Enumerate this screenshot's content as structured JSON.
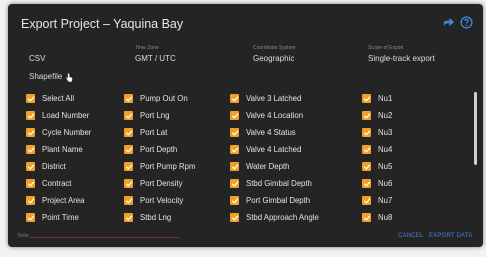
{
  "dialog": {
    "title": "Export Project – Yaquina Bay",
    "icons": [
      "share-arrow-icon",
      "help-icon"
    ],
    "accent_color": "#f0a125",
    "link_color": "#3d86d6"
  },
  "options": {
    "format": {
      "label": "",
      "value": "CSV",
      "value2": "Shapefile"
    },
    "time_zone": {
      "label": "Time Zone",
      "value": "GMT / UTC"
    },
    "coordinate_system": {
      "label": "Coordinate System",
      "value": "Geographic"
    },
    "scope": {
      "label": "Scope of Export",
      "value": "Single-track export"
    }
  },
  "fields": {
    "col1": [
      "Select All",
      "Load Number",
      "Cycle Number",
      "Plant Name",
      "District",
      "Contract",
      "Project Area",
      "Point Time"
    ],
    "col2": [
      "Pump Out On",
      "Port Lng",
      "Port Lat",
      "Port Depth",
      "Port Pump Rpm",
      "Port Density",
      "Port Velocity",
      "Stbd Lng"
    ],
    "col3": [
      "Valve 3 Latched",
      "Valve 4 Location",
      "Valve 4 Status",
      "Valve 4 Latched",
      "Water Depth",
      "Stbd Gimbal Depth",
      "Port Gimbal Depth",
      "Stbd Approach Angle"
    ],
    "col4": [
      "Nu1",
      "Nu2",
      "Nu3",
      "Nu4",
      "Nu5",
      "Nu6",
      "Nu7",
      "Nu8"
    ]
  },
  "footer": {
    "hint": "Note:",
    "cancel_label": "CANCEL",
    "export_label": "EXPORT DATA"
  }
}
